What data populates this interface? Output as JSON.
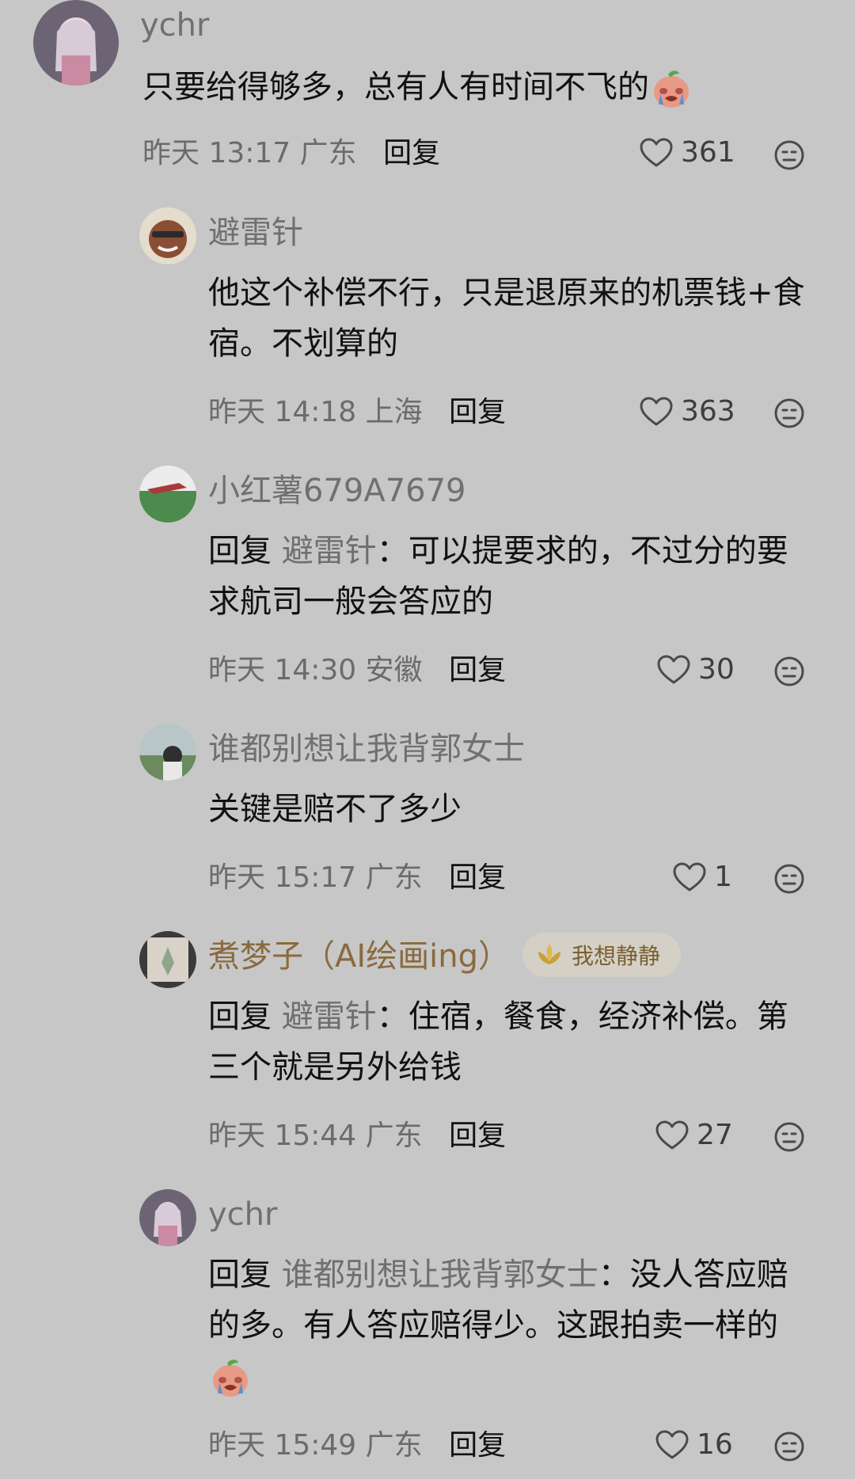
{
  "comments": [
    {
      "username": "ychr",
      "text": "只要给得够多，总有人有时间不飞的",
      "date": "昨天",
      "time": "13:17",
      "location": "广东",
      "reply_label": "回复",
      "likes": "361"
    },
    {
      "username": "避雷针",
      "text_line1": "他这个补偿不行，只是退原来的机票钱+食",
      "text_line2": "宿。不划算的",
      "date": "昨天",
      "time": "14:18",
      "location": "上海",
      "reply_label": "回复",
      "likes": "363"
    },
    {
      "username": "小红薯679A7679",
      "reply_prefix": "回复",
      "reply_to": "避雷针",
      "text_line1": "：可以提要求的，不过分的要",
      "text_line2": "求航司一般会答应的",
      "date": "昨天",
      "time": "14:30",
      "location": "安徽",
      "reply_label": "回复",
      "likes": "30"
    },
    {
      "username": "谁都别想让我背郭女士",
      "text": "关键是赔不了多少",
      "date": "昨天",
      "time": "15:17",
      "location": "广东",
      "reply_label": "回复",
      "likes": "1"
    },
    {
      "username": "煮梦子（AI绘画ing）",
      "badge": "我想静静",
      "reply_prefix": "回复",
      "reply_to": "避雷针",
      "text_line1": "：住宿，餐食，经济补偿。第",
      "text_line2": "三个就是另外给钱",
      "date": "昨天",
      "time": "15:44",
      "location": "广东",
      "reply_label": "回复",
      "likes": "27"
    },
    {
      "username": "ychr",
      "reply_prefix": "回复",
      "reply_to": "谁都别想让我背郭女士",
      "text_line1": "：没人答应赔",
      "text_line2": "的多。有人答应赔得少。这跟拍卖一样的",
      "date": "昨天",
      "time": "15:49",
      "location": "广东",
      "reply_label": "回复",
      "likes": "16"
    }
  ],
  "colors": {
    "background": "#c7c7c7",
    "text": "#111111",
    "meta": "#6b6b6b",
    "username": "#707070",
    "username_gold": "#8a6a3e",
    "badge_bg": "#d4d0c6"
  },
  "icons": {
    "like": "heart-outline-icon",
    "dislike": "neutral-face-icon",
    "emoji": "crying-peach-emoji"
  }
}
